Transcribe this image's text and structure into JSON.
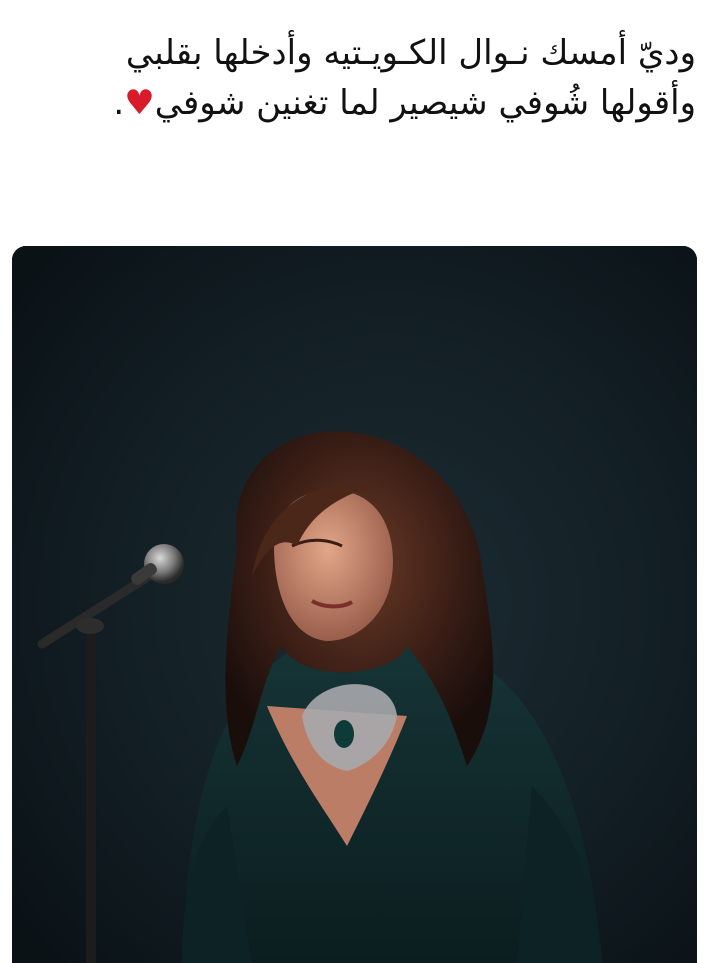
{
  "post": {
    "line1": "وديّ أمسك نـوال الكـويـتيه وأدخلها بقلبي",
    "line2": "وأقولها شُوفي شيصير لما تغنين شوفي",
    "trailing_punctuation": ".",
    "emoji": "♥"
  },
  "photo": {
    "subject": "singer-on-stage",
    "colors": {
      "background": "#0f1a1f",
      "dress": "#0f2a2c",
      "hair": "#3a1e16",
      "skin": "#c98a72"
    }
  }
}
